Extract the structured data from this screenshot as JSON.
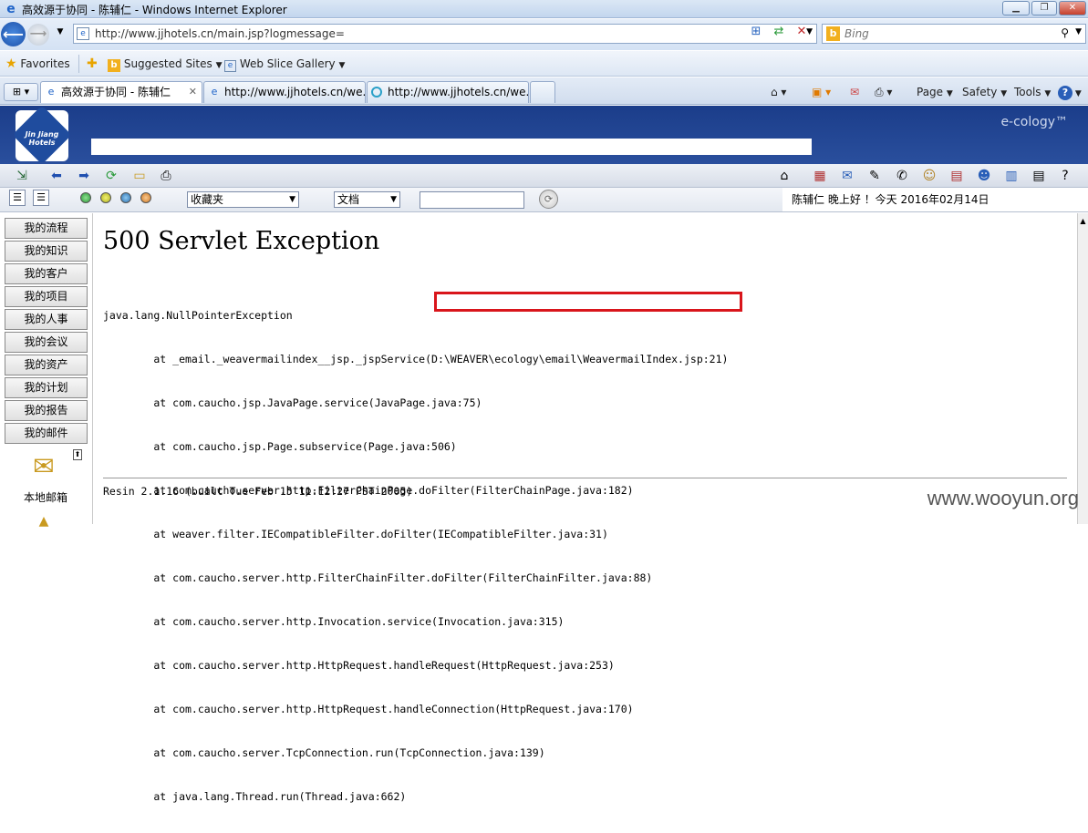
{
  "window": {
    "title": "高效源于协同 - 陈辅仁 - Windows Internet Explorer"
  },
  "address": {
    "url": "http://www.jjhotels.cn/main.jsp?logmessage="
  },
  "search": {
    "placeholder": "Bing"
  },
  "favorites": {
    "label": "Favorites",
    "suggested": "Suggested Sites",
    "webslice": "Web Slice Gallery"
  },
  "tabs": [
    {
      "label": "高效源于协同 - 陈辅仁"
    },
    {
      "label": "http://www.jjhotels.cn/we..."
    },
    {
      "label": "http://www.jjhotels.cn/we..."
    }
  ],
  "commands": {
    "page": "Page",
    "safety": "Safety",
    "tools": "Tools"
  },
  "brand": {
    "logo_text": "Jin Jiang Hotels",
    "product": "e-cology™"
  },
  "toolbar2": {
    "favorites_select": "收藏夹",
    "doc_select": "文档",
    "greeting": "陈辅仁 晚上好 ！今天 2016年02月14日"
  },
  "sidebar": {
    "items": [
      "我的流程",
      "我的知识",
      "我的客户",
      "我的项目",
      "我的人事",
      "我的会议",
      "我的资产",
      "我的计划",
      "我的报告",
      "我的邮件"
    ],
    "local_mailbox": "本地邮箱"
  },
  "content": {
    "error_title": "500 Servlet Exception",
    "trace": [
      "java.lang.NullPointerException",
      "        at _email._weavermailindex__jsp._jspService(D:\\WEAVER\\ecology\\email\\WeavermailIndex.jsp:21)",
      "        at com.caucho.jsp.JavaPage.service(JavaPage.java:75)",
      "        at com.caucho.jsp.Page.subservice(Page.java:506)",
      "        at com.caucho.server.http.FilterChainPage.doFilter(FilterChainPage.java:182)",
      "        at weaver.filter.IECompatibleFilter.doFilter(IECompatibleFilter.java:31)",
      "        at com.caucho.server.http.FilterChainFilter.doFilter(FilterChainFilter.java:88)",
      "        at com.caucho.server.http.Invocation.service(Invocation.java:315)",
      "        at com.caucho.server.http.HttpRequest.handleRequest(HttpRequest.java:253)",
      "        at com.caucho.server.http.HttpRequest.handleConnection(HttpRequest.java:170)",
      "        at com.caucho.server.TcpConnection.run(TcpConnection.java:139)",
      "        at java.lang.Thread.run(Thread.java:662)"
    ],
    "server_footer": "Resin 2.1.16 (built Tue Feb 15 11:12:27 PST 2005)",
    "highlight_color": "#d9151b"
  },
  "watermark": "www.wooyun.org"
}
